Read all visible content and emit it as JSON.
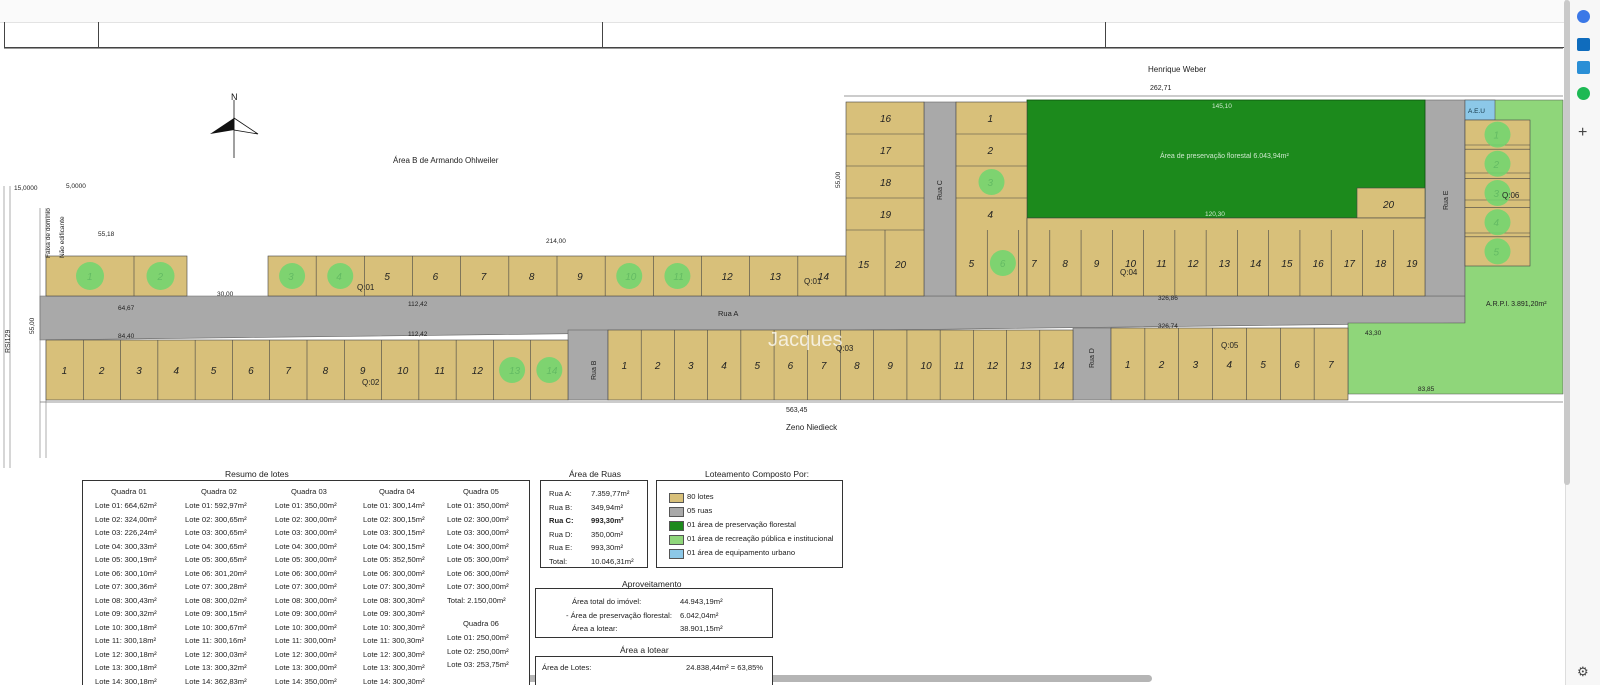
{
  "plan": {
    "street_top": "Henrique Weber",
    "street_bottom": "Zeno Niedieck",
    "area_b": "Área B de Armando Ohlweiler",
    "highway": "RSI129",
    "faixa_dominio": "Faixa de domínio",
    "nao_edificante": "Não edificante",
    "dim_15": "15,0000",
    "dim_5": "5,0000",
    "dim_55_18": "55,18",
    "dim_214": "214,00",
    "dim_55_left": "55,00",
    "dim_55_right": "55,00",
    "dim_262": "262,71",
    "dim_30": "30,00",
    "dim_64": "64,67",
    "dim_84": "84,40",
    "dim_112a": "112,42",
    "dim_112b": "112,42",
    "dim_326a": "326,86",
    "dim_326b": "326,74",
    "dim_563": "563,45",
    "dim_43": "43,30",
    "dim_83": "83,85",
    "dim_145": "145,10",
    "dim_120": "120,30",
    "rua_a": "Rua A",
    "rua_b": "Rua B",
    "rua_c": "Rua C",
    "rua_d": "Rua D",
    "rua_e": "Rua E",
    "preservation_label": "Área de preservação florestal 6.043,94m²",
    "arpi_label": "A.R.P.I. 3.891,20m²",
    "aeu_label": "A.E.U",
    "watermark": "Jacques",
    "q01": "Q:01",
    "q02": "Q:02",
    "q03": "Q:03",
    "q04": "Q:04",
    "q05": "Q:05",
    "q06": "Q:06",
    "north": "N"
  },
  "lots": {
    "q01": [
      "1",
      "2",
      "3",
      "4",
      "5",
      "6",
      "7",
      "8",
      "9",
      "10",
      "11",
      "12",
      "13",
      "14",
      "15",
      "16",
      "17",
      "18",
      "19",
      "20"
    ],
    "q02": [
      "1",
      "2",
      "3",
      "4",
      "5",
      "6",
      "7",
      "8",
      "9",
      "10",
      "11",
      "12",
      "13",
      "14"
    ],
    "q03": [
      "1",
      "2",
      "3",
      "4",
      "5",
      "6",
      "7",
      "8",
      "9",
      "10",
      "11",
      "12",
      "13",
      "14"
    ],
    "q04_top": [
      "16",
      "17",
      "18",
      "19"
    ],
    "q04_col": [
      "1",
      "2",
      "3",
      "4"
    ],
    "q04_row": [
      "5",
      "6",
      "7",
      "8",
      "9",
      "10",
      "11",
      "12",
      "13",
      "14",
      "15",
      "16",
      "17",
      "18",
      "19"
    ],
    "q04_20": "20",
    "q05": [
      "1",
      "2",
      "3",
      "4",
      "5",
      "6",
      "7"
    ],
    "q06": [
      "1",
      "2",
      "3",
      "4",
      "5"
    ]
  },
  "resumo": {
    "title": "Resumo de lotes",
    "headers": [
      "Quadra 01",
      "Quadra 02",
      "Quadra 03",
      "Quadra 04",
      "Quadra 05"
    ],
    "q01": [
      "Lote 01: 664,62m²",
      "Lote 02: 324,00m²",
      "Lote 03: 226,24m²",
      "Lote 04: 300,33m²",
      "Lote 05: 300,19m²",
      "Lote 06: 300,10m²",
      "Lote 07: 300,36m²",
      "Lote 08: 300,43m²",
      "Lote 09: 300,32m²",
      "Lote 10: 300,18m²",
      "Lote 11: 300,18m²",
      "Lote 12: 300,18m²",
      "Lote 13: 300,18m²",
      "Lote 14: 300,18m²"
    ],
    "q02": [
      "Lote 01: 592,97m²",
      "Lote 02: 300,65m²",
      "Lote 03: 300,65m²",
      "Lote 04: 300,65m²",
      "Lote 05: 300,65m²",
      "Lote 06: 301,20m²",
      "Lote 07: 300,28m²",
      "Lote 08: 300,02m²",
      "Lote 09: 300,15m²",
      "Lote 10: 300,67m²",
      "Lote 11: 300,16m²",
      "Lote 12: 300,03m²",
      "Lote 13: 300,32m²",
      "Lote 14: 362,83m²"
    ],
    "q03": [
      "Lote 01: 350,00m²",
      "Lote 02: 300,00m²",
      "Lote 03: 300,00m²",
      "Lote 04: 300,00m²",
      "Lote 05: 300,00m²",
      "Lote 06: 300,00m²",
      "Lote 07: 300,00m²",
      "Lote 08: 300,00m²",
      "Lote 09: 300,00m²",
      "Lote 10: 300,00m²",
      "Lote 11: 300,00m²",
      "Lote 12: 300,00m²",
      "Lote 13: 300,00m²",
      "Lote 14: 350,00m²"
    ],
    "q04": [
      "Lote 01: 300,14m²",
      "Lote 02: 300,15m²",
      "Lote 03: 300,15m²",
      "Lote 04: 300,15m²",
      "Lote 05: 352,50m²",
      "Lote 06: 300,00m²",
      "Lote 07: 300,30m²",
      "Lote 08: 300,30m²",
      "Lote 09: 300,30m²",
      "Lote 10: 300,30m²",
      "Lote 11: 300,30m²",
      "Lote 12: 300,30m²",
      "Lote 13: 300,30m²",
      "Lote 14: 300,30m²"
    ],
    "q05": [
      "Lote 01: 350,00m²",
      "Lote 02: 300,00m²",
      "Lote 03: 300,00m²",
      "Lote 04: 300,00m²",
      "Lote 05: 300,00m²",
      "Lote 06: 300,00m²",
      "Lote 07: 300,00m²",
      "Total: 2.150,00m²"
    ],
    "q06_header": "Quadra 06",
    "q06": [
      "Lote 01: 250,00m²",
      "Lote 02: 250,00m²",
      "Lote 03: 253,75m²"
    ]
  },
  "ruas": {
    "title": "Área de Ruas",
    "rows": [
      {
        "k": "Rua A:",
        "v": "7.359,77m²"
      },
      {
        "k": "Rua B:",
        "v": "349,94m²"
      },
      {
        "k": "Rua C:",
        "v": "993,30m²"
      },
      {
        "k": "Rua D:",
        "v": "350,00m²"
      },
      {
        "k": "Rua E:",
        "v": "993,30m²"
      },
      {
        "k": "Total:",
        "v": "10.046,31m²"
      }
    ]
  },
  "legend": {
    "title": "Loteamento Composto Por:",
    "items": [
      {
        "label": "80 lotes",
        "color": "#d8c07a"
      },
      {
        "label": "05 ruas",
        "color": "#a9a9a9"
      },
      {
        "label": "01 área de preservação florestal",
        "color": "#1c8a1c"
      },
      {
        "label": "01 área de recreação pública e institucional",
        "color": "#8fd67a"
      },
      {
        "label": "01 área de equipamento urbano",
        "color": "#8cc8e8"
      }
    ]
  },
  "aproveitamento": {
    "title": "Aproveitamento",
    "rows": [
      {
        "k": "Área total do imóvel:",
        "v": "44.943,19m²"
      },
      {
        "k": "- Área de preservação florestal:",
        "v": "6.042,04m²"
      },
      {
        "k": "Área a lotear:",
        "v": "38.901,15m²"
      }
    ]
  },
  "lotear": {
    "title": "Área a lotear",
    "k": "Área de Lotes:",
    "v": "24.838,44m² = 63,85%"
  }
}
